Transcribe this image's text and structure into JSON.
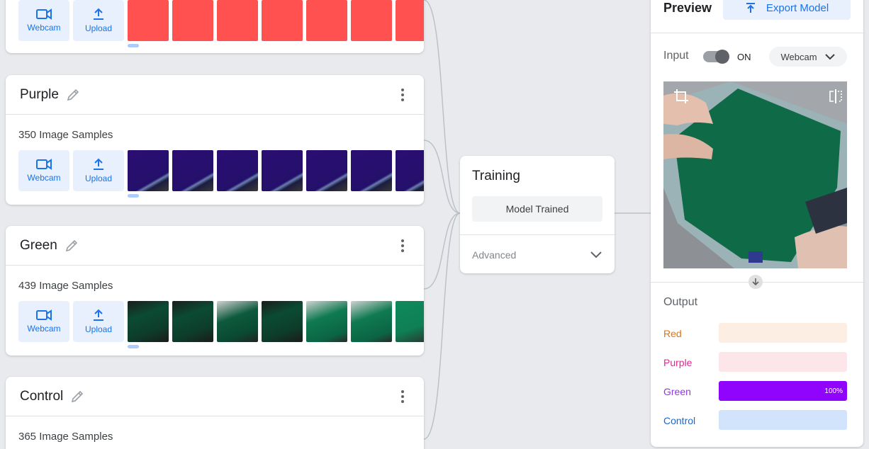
{
  "classes": [
    {
      "name": "",
      "samples": "",
      "webcam_label": "Webcam",
      "upload_label": "Upload",
      "thumb_style": "red"
    },
    {
      "name": "Purple",
      "samples": "350 Image Samples",
      "webcam_label": "Webcam",
      "upload_label": "Upload",
      "thumb_style": "purple"
    },
    {
      "name": "Green",
      "samples": "439 Image Samples",
      "webcam_label": "Webcam",
      "upload_label": "Upload",
      "thumb_style": "green"
    },
    {
      "name": "Control",
      "samples": "365 Image Samples",
      "webcam_label": "Webcam",
      "upload_label": "Upload",
      "thumb_style": "none"
    }
  ],
  "training": {
    "title": "Training",
    "status_button": "Model Trained",
    "advanced_label": "Advanced"
  },
  "preview": {
    "title": "Preview",
    "export_label": "Export Model",
    "input_label": "Input",
    "toggle_state": "ON",
    "source_select": "Webcam",
    "output_label": "Output",
    "outputs": [
      {
        "label": "Red",
        "color": "#e8710a",
        "track": "#fdeee3",
        "fill": "#e8710a",
        "confidence": 0,
        "percent_text": ""
      },
      {
        "label": "Purple",
        "color": "#e52592",
        "track": "#fde6ea",
        "fill": "#e52592",
        "confidence": 0,
        "percent_text": ""
      },
      {
        "label": "Green",
        "color": "#9334e6",
        "track": "#efe3fd",
        "fill": "#9003fc",
        "confidence": 1.0,
        "percent_text": "100%"
      },
      {
        "label": "Control",
        "color": "#1967d2",
        "track": "#d2e3fc",
        "fill": "#1967d2",
        "confidence": 0,
        "percent_text": ""
      }
    ]
  },
  "colors": {
    "accent": "#1a73e8",
    "red_sample": "#ff5250"
  }
}
